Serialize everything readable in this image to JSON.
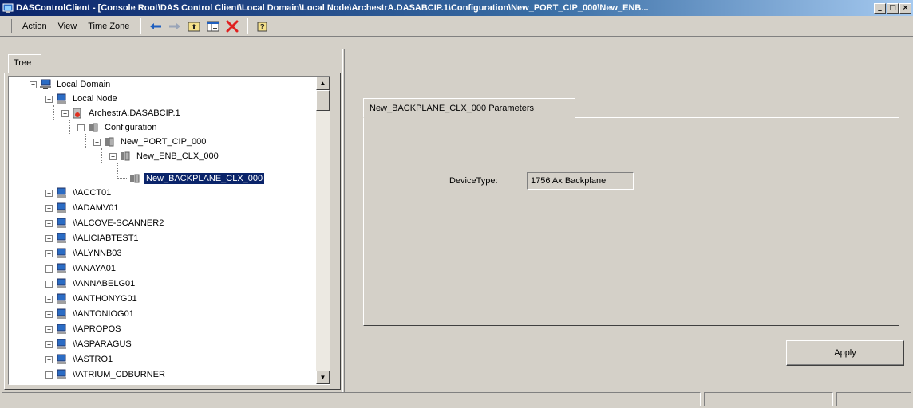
{
  "window": {
    "title": "DASControlClient - [Console Root\\DAS Control Client\\Local Domain\\Local Node\\ArchestrA.DASABCIP.1\\Configuration\\New_PORT_CIP_000\\New_ENB...",
    "minimize": "_",
    "restore": "□",
    "close": "×"
  },
  "menu": {
    "action": "Action",
    "view": "View",
    "time_zone": "Time Zone"
  },
  "left_tab": {
    "label": "Tree"
  },
  "tree": {
    "root": "Local Domain",
    "local_node": "Local Node",
    "archestra": "ArchestrA.DASABCIP.1",
    "configuration": "Configuration",
    "port": "New_PORT_CIP_000",
    "enb": "New_ENB_CLX_000",
    "backplane": "New_BACKPLANE_CLX_000",
    "nodes": [
      "\\\\ACCT01",
      "\\\\ADAMV01",
      "\\\\ALCOVE-SCANNER2",
      "\\\\ALICIABTEST1",
      "\\\\ALYNNB03",
      "\\\\ANAYA01",
      "\\\\ANNABELG01",
      "\\\\ANTHONYG01",
      "\\\\ANTONIOG01",
      "\\\\APROPOS",
      "\\\\ASPARAGUS",
      "\\\\ASTRO1",
      "\\\\ATRIUM_CDBURNER"
    ]
  },
  "params": {
    "tab_label": "New_BACKPLANE_CLX_000 Parameters",
    "device_type_label": "DeviceType:",
    "device_type_value": "1756 Ax Backplane",
    "apply": "Apply"
  },
  "icons": {
    "app": "console-icon",
    "back": "arrow-left-icon",
    "forward": "arrow-right-icon",
    "up": "up-folder-icon",
    "show_hide_tree": "show-hide-tree-icon",
    "delete": "red-x-icon",
    "help": "help-icon"
  }
}
